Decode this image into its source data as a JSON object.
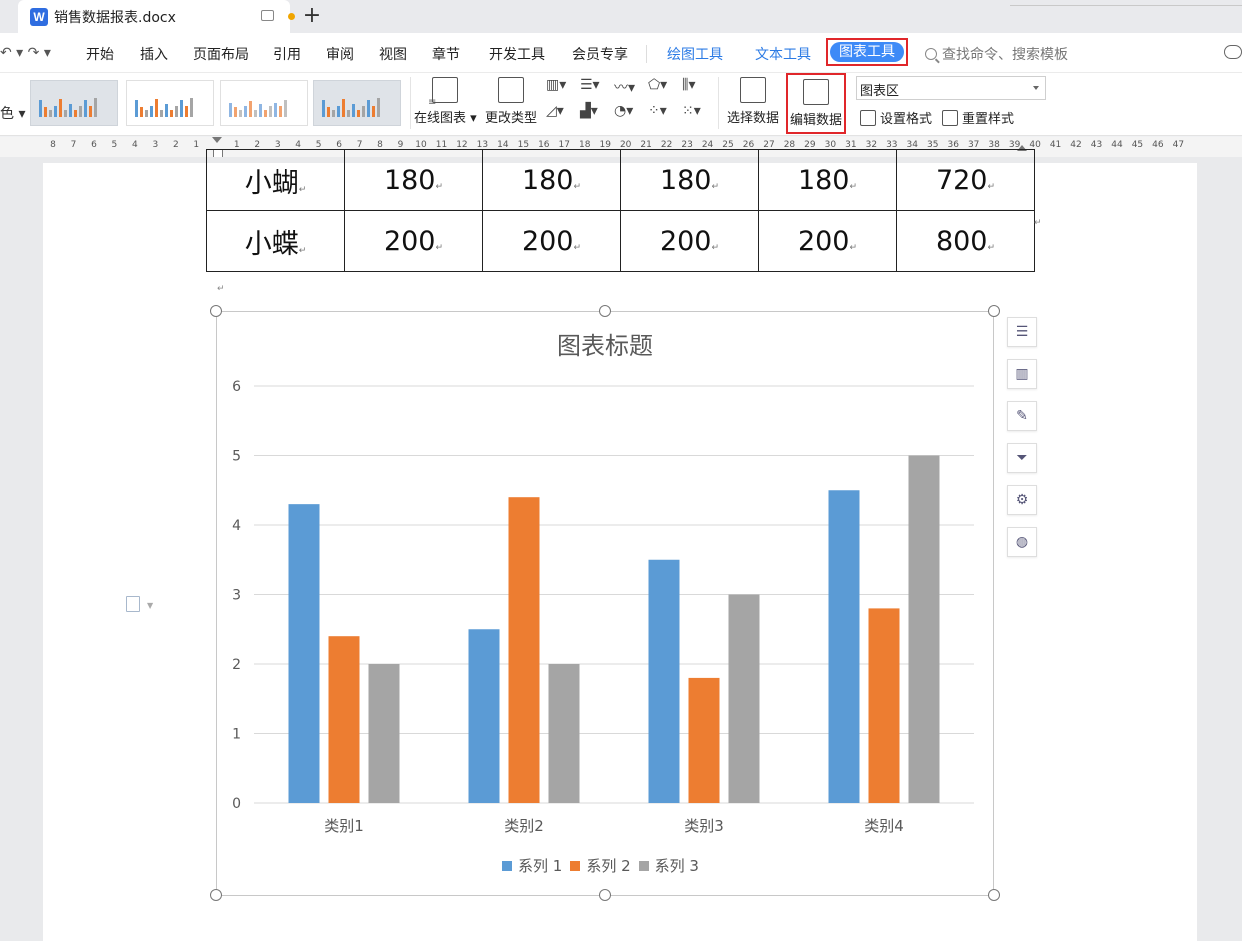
{
  "tab": {
    "title": "销售数据报表.docx",
    "new_tab": "+"
  },
  "menu": {
    "undo": "↶ ▾  ↷  ▾",
    "items": [
      "开始",
      "插入",
      "页面布局",
      "引用",
      "审阅",
      "视图",
      "章节",
      "开发工具",
      "会员专享"
    ],
    "tools": [
      "绘图工具",
      "文本工具"
    ],
    "active_tool": "图表工具",
    "search_placeholder": "查找命令、搜索模板"
  },
  "ribbon": {
    "left_stub": "色 ▾",
    "buttons": {
      "online_chart": "在线图表 ▾",
      "change_type": "更改类型",
      "select_data": "选择数据",
      "edit_data": "编辑数据",
      "set_format": "设置格式",
      "reset_style": "重置样式"
    },
    "element_dropdown": {
      "value": "图表区"
    }
  },
  "ruler": [
    "8",
    "7",
    "6",
    "5",
    "4",
    "3",
    "2",
    "1",
    "1",
    "2",
    "3",
    "4",
    "5",
    "6",
    "7",
    "8",
    "9",
    "10",
    "11",
    "12",
    "13",
    "14",
    "15",
    "16",
    "17",
    "18",
    "19",
    "20",
    "21",
    "22",
    "23",
    "24",
    "25",
    "26",
    "27",
    "28",
    "29",
    "30",
    "31",
    "32",
    "33",
    "34",
    "35",
    "36",
    "37",
    "38",
    "39",
    "40",
    "41",
    "42",
    "43",
    "44",
    "45",
    "46",
    "47"
  ],
  "table": {
    "rows": [
      {
        "name": "小蝴",
        "values": [
          "180",
          "180",
          "180",
          "180",
          "720"
        ]
      },
      {
        "name": "小蝶",
        "values": [
          "200",
          "200",
          "200",
          "200",
          "800"
        ]
      }
    ]
  },
  "chart_data": {
    "type": "bar",
    "title": "图表标题",
    "categories": [
      "类别1",
      "类别2",
      "类别3",
      "类别4"
    ],
    "series": [
      {
        "name": "系列 1",
        "values": [
          4.3,
          2.5,
          3.5,
          4.5
        ],
        "color": "#5b9bd5"
      },
      {
        "name": "系列 2",
        "values": [
          2.4,
          4.4,
          1.8,
          2.8
        ],
        "color": "#ed7d31"
      },
      {
        "name": "系列 3",
        "values": [
          2,
          2,
          3,
          5
        ],
        "color": "#a5a5a5"
      }
    ],
    "ylim": [
      0,
      6
    ],
    "yticks": [
      "0",
      "1",
      "2",
      "3",
      "4",
      "5",
      "6"
    ],
    "grid": true,
    "legend": "bottom"
  }
}
